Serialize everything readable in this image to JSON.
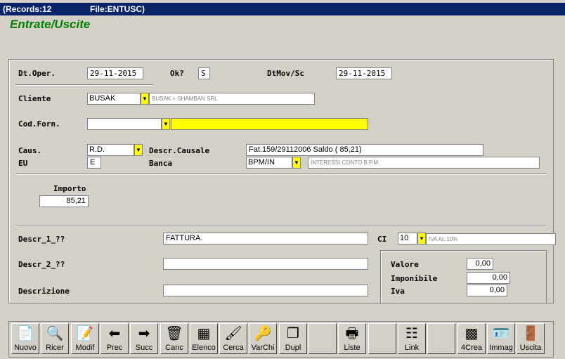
{
  "window": {
    "records": "(Records:12",
    "file": "File:ENTUSC)"
  },
  "page_title": "Entrate/Uscite",
  "form": {
    "dt_oper_label": "Dt.Oper.",
    "dt_oper": "29-11-2015",
    "ok_label": "Ok?",
    "ok": "S",
    "dtmov_label": "DtMov/Sc",
    "dtmov": "29-11-2015",
    "cliente_label": "Cliente",
    "cliente": "BUSAK",
    "cliente_desc": "BUSAK + SHAMBAN SRL",
    "codforn_label": "Cod.Forn.",
    "codforn": "",
    "codforn_desc": "",
    "caus_label": "Caus.",
    "caus": "R.D.",
    "descr_causale_label": "Descr.Causale",
    "descr_causale": "Fat.159/29112006 Saldo (     85,21)",
    "eu_label": "EU",
    "eu": "E",
    "banca_label": "Banca",
    "banca": "BPM/IN",
    "banca_desc": "INTERESSI CONTO B.P.M.",
    "importo_label": "Importo",
    "importo": "85,21",
    "descr1_label": "Descr_1_??",
    "descr1": "FATTURA.",
    "ci_label": "CI",
    "ci": "10",
    "ci_desc": "IVA AL 10%",
    "descr2_label": "Descr_2_??",
    "descr2": "",
    "descrizione_label": "Descrizione",
    "descrizione": "",
    "valore_label": "Valore",
    "valore": "0,00",
    "imponibile_label": "Imponibile",
    "imponibile": "0,00",
    "iva_label": "Iva",
    "iva": "0,00"
  },
  "toolbar": [
    {
      "label": "Nuovo",
      "icon": "new-doc-icon",
      "glyph": "📄"
    },
    {
      "label": "Ricer",
      "icon": "magnifier-icon",
      "glyph": "🔍"
    },
    {
      "label": "Modif",
      "icon": "edit-doc-icon",
      "glyph": "📝"
    },
    {
      "label": "Prec",
      "icon": "arrow-left-icon",
      "glyph": "⬅"
    },
    {
      "label": "Succ",
      "icon": "arrow-right-icon",
      "glyph": "➡"
    },
    {
      "label": "Canc",
      "icon": "trash-icon",
      "glyph": "🗑"
    },
    {
      "label": "Elenco",
      "icon": "list-grid-icon",
      "glyph": "▦"
    },
    {
      "label": "Cerca",
      "icon": "brush-icon",
      "glyph": "🖌"
    },
    {
      "label": "VarChi",
      "icon": "keys-icon",
      "glyph": "🔑"
    },
    {
      "label": "Dupl",
      "icon": "copy-icon",
      "glyph": "❐"
    },
    {
      "label": "",
      "icon": "",
      "glyph": ""
    },
    {
      "label": "Liste",
      "icon": "printer-icon",
      "glyph": "🖶"
    },
    {
      "label": "",
      "icon": "",
      "glyph": ""
    },
    {
      "label": "Link",
      "icon": "link-icon",
      "glyph": "☷"
    },
    {
      "label": "",
      "icon": "",
      "glyph": ""
    },
    {
      "label": "4Crea",
      "icon": "create-icon",
      "glyph": "▩"
    },
    {
      "label": "Immag",
      "icon": "image-card-icon",
      "glyph": "🪪"
    },
    {
      "label": "Uscita",
      "icon": "exit-door-icon",
      "glyph": "🚪"
    }
  ]
}
